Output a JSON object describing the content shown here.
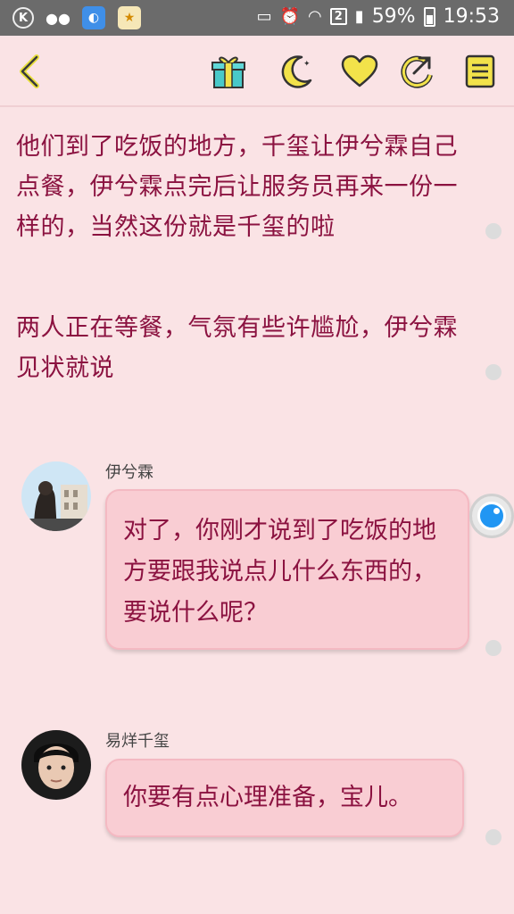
{
  "statusbar": {
    "battery": "59%",
    "time": "19:53",
    "sim": "2",
    "left_icons": [
      "k-app-icon",
      "wechat-icon",
      "browser-icon",
      "star-app-icon"
    ]
  },
  "toolbar": {
    "icons": [
      "back-icon",
      "gift-icon",
      "moon-icon",
      "heart-icon",
      "share-icon",
      "menu-book-icon"
    ],
    "accent": "#e8e03a"
  },
  "story": {
    "paragraphs": [
      "他们到了吃饭的地方，千玺让伊兮霖自己点餐，伊兮霖点完后让服务员再来一份一样的，当然这份就是千玺的啦",
      "两人正在等餐，气氛有些许尴尬，伊兮霖见状就说"
    ],
    "messages": [
      {
        "name": "伊兮霖",
        "text": "对了，你刚才说到了吃饭的地方要跟我说点儿什么东西的，要说什么呢？"
      },
      {
        "name": "易烊千玺",
        "text": "你要有点心理准备，宝儿。"
      }
    ]
  },
  "colors": {
    "background": "#fae3e5",
    "text": "#8b1240",
    "bubble": "#f9cdd3",
    "statusbar": "#6b6b6b"
  }
}
